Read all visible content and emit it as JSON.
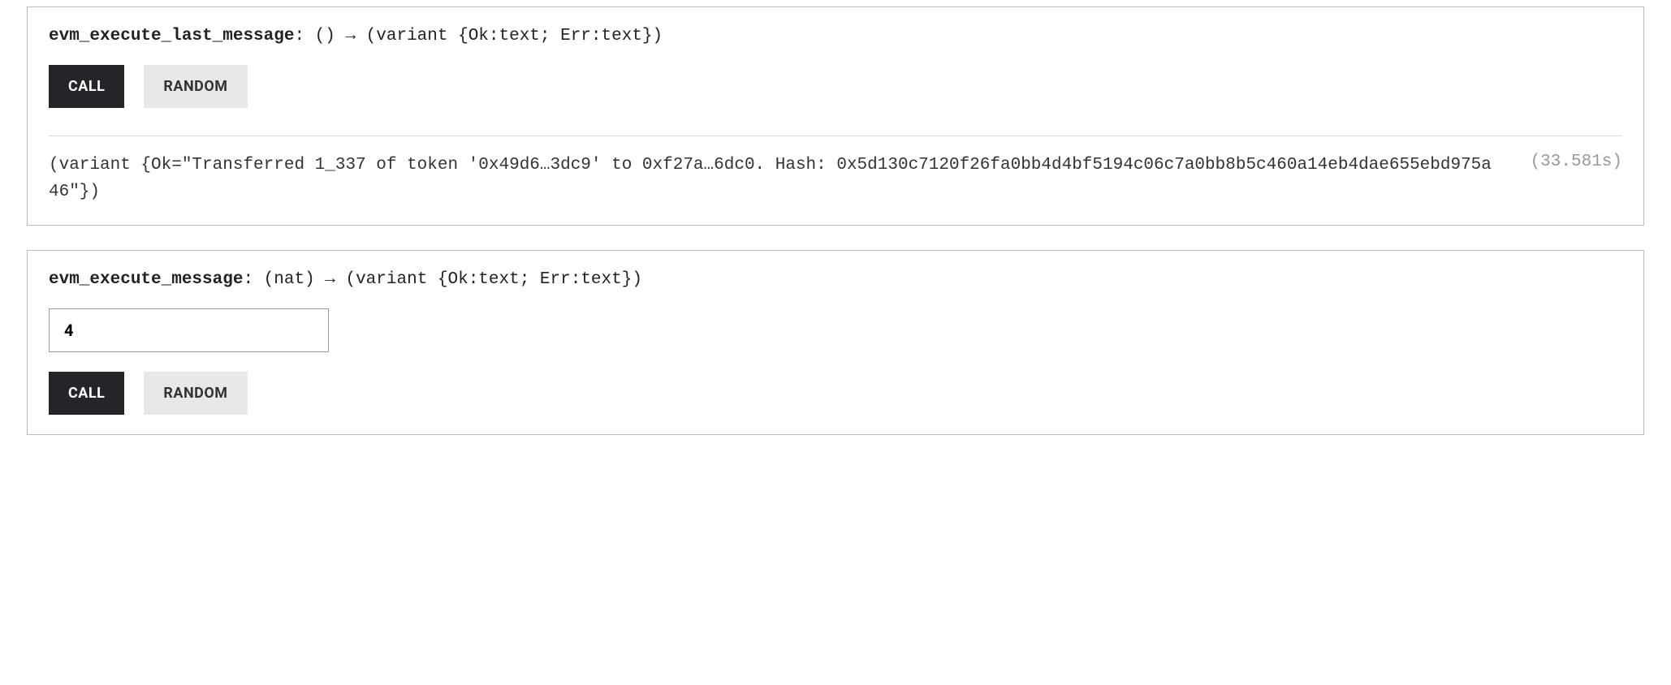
{
  "cards": [
    {
      "name": "evm_execute_last_message",
      "sig_rest": ": () → (variant {Ok:text; Err:text})",
      "call_label": "CALL",
      "random_label": "RANDOM",
      "result": "(variant {Ok=\"Transferred 1_337 of token '0x49d6…3dc9' to 0xf27a…6dc0. Hash: 0x5d130c7120f26fa0bb4d4bf5194c06c7a0bb8b5c460a14eb4dae655ebd975a46\"})",
      "timing": "(33.581s)"
    },
    {
      "name": "evm_execute_message",
      "sig_rest": ": (nat) → (variant {Ok:text; Err:text})",
      "input_value": "4",
      "call_label": "CALL",
      "random_label": "RANDOM"
    }
  ]
}
